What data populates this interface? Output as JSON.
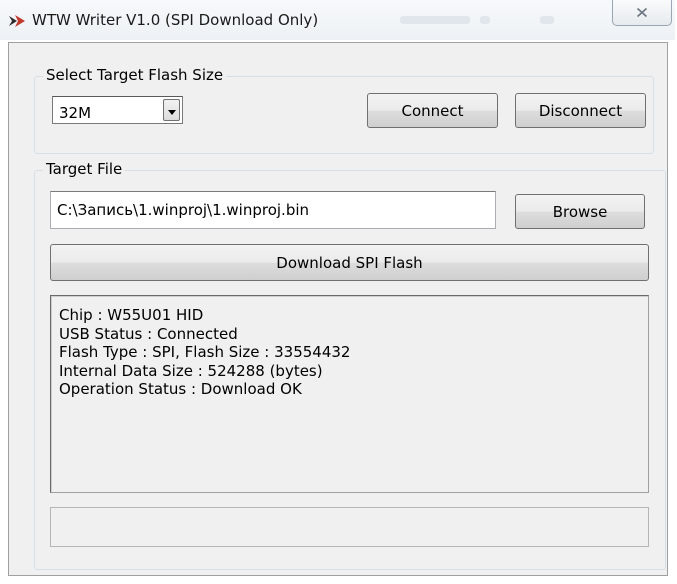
{
  "window": {
    "title": "WTW Writer V1.0 (SPI Download Only)",
    "icon": "app-logo-icon",
    "close_icon": "close-icon"
  },
  "flash_size_group": {
    "label": "Select Target Flash Size",
    "selected": "32M",
    "connect_label": "Connect",
    "disconnect_label": "Disconnect"
  },
  "target_file_group": {
    "label": "Target File",
    "path_value": "C:\\Запись\\1.winproj\\1.winproj.bin",
    "browse_label": "Browse",
    "download_label": "Download SPI Flash"
  },
  "log": {
    "lines": [
      "Chip : W55U01 HID",
      "USB Status : Connected",
      "Flash Type : SPI, Flash Size : 33554432",
      "Internal Data Size : 524288 (bytes)",
      "Operation Status : Download OK"
    ]
  },
  "status": {
    "text": ""
  },
  "colors": {
    "dialog_bg": "#f0f0f0",
    "title_bg": "#edf1f5",
    "icon_red": "#c0392b"
  }
}
